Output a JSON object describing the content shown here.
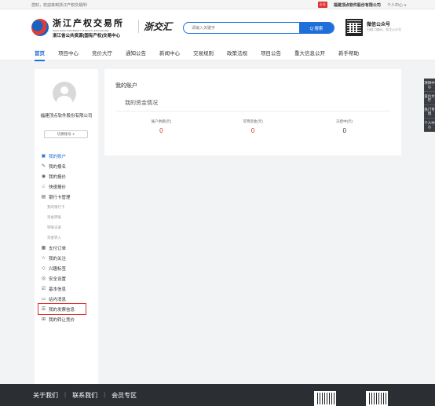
{
  "topbar": {
    "welcome": "您好，欢迎来到浙江产权交易所!",
    "badge": "企业",
    "company": "福建顶点软件股份有限公司",
    "personal_center": "个人中心 ∨"
  },
  "header": {
    "logo_cn": "浙江产权交易所",
    "logo_en": "ZHEJIANG PROPERTY RIGHTS EXCHANGE",
    "logo_sub": "浙江省公共资源(国有产权)交易中心",
    "zjh_brand": "浙交汇",
    "search_placeholder": "请输入关键字",
    "search_button": "Q 搜索",
    "wechat_title": "微信公众号",
    "wechat_sub": "扫描二维码，关注公众号"
  },
  "nav": {
    "items": [
      "首页",
      "项目中心",
      "竞价大厅",
      "通知公告",
      "新闻中心",
      "交易规则",
      "政策法规",
      "项目公告",
      "重大信息公开",
      "新手帮助"
    ]
  },
  "sidebar": {
    "user_name": "福建顶点软件股份有限公司",
    "switch_account": "切换账号 ∨",
    "menu": [
      {
        "icon": "▣",
        "label": "我的账户",
        "active": true
      },
      {
        "icon": "✎",
        "label": "我的报名"
      },
      {
        "icon": "◉",
        "label": "我的报价"
      },
      {
        "icon": "♧",
        "label": "快速报价"
      },
      {
        "icon": "▤",
        "label": "银行卡管理"
      },
      {
        "icon": "",
        "label": "我的银行卡",
        "sub": true
      },
      {
        "icon": "",
        "label": "资金转账",
        "sub": true
      },
      {
        "icon": "",
        "label": "转账记录",
        "sub": true
      },
      {
        "icon": "",
        "label": "资金转入",
        "sub": true
      },
      {
        "icon": "▦",
        "label": "支付订单"
      },
      {
        "icon": "☆",
        "label": "我的关注"
      },
      {
        "icon": "◇",
        "label": "兴趣标签"
      },
      {
        "icon": "◎",
        "label": "安全设置"
      },
      {
        "icon": "☑",
        "label": "基本信息"
      },
      {
        "icon": "▭",
        "label": "站内消息"
      },
      {
        "icon": "☰",
        "label": "我的发票信息",
        "highlight": true
      },
      {
        "icon": "⊞",
        "label": "我的转让竞价"
      }
    ]
  },
  "main": {
    "title": "我的账户",
    "subtitle": "我的资金情况",
    "stats": [
      {
        "label": "账户余额(元)",
        "value": "0",
        "color": "#e0302f"
      },
      {
        "label": "可用资金(元)",
        "value": "0",
        "color": "#e0302f"
      },
      {
        "label": "冻结中(元)",
        "value": "0",
        "color": "#333333"
      }
    ]
  },
  "float_bar": [
    "项目中心",
    "竞价大厅",
    "热门专场",
    "个人中心"
  ],
  "footer": {
    "links": [
      "关于我们",
      "联系我们",
      "会员专区"
    ]
  }
}
